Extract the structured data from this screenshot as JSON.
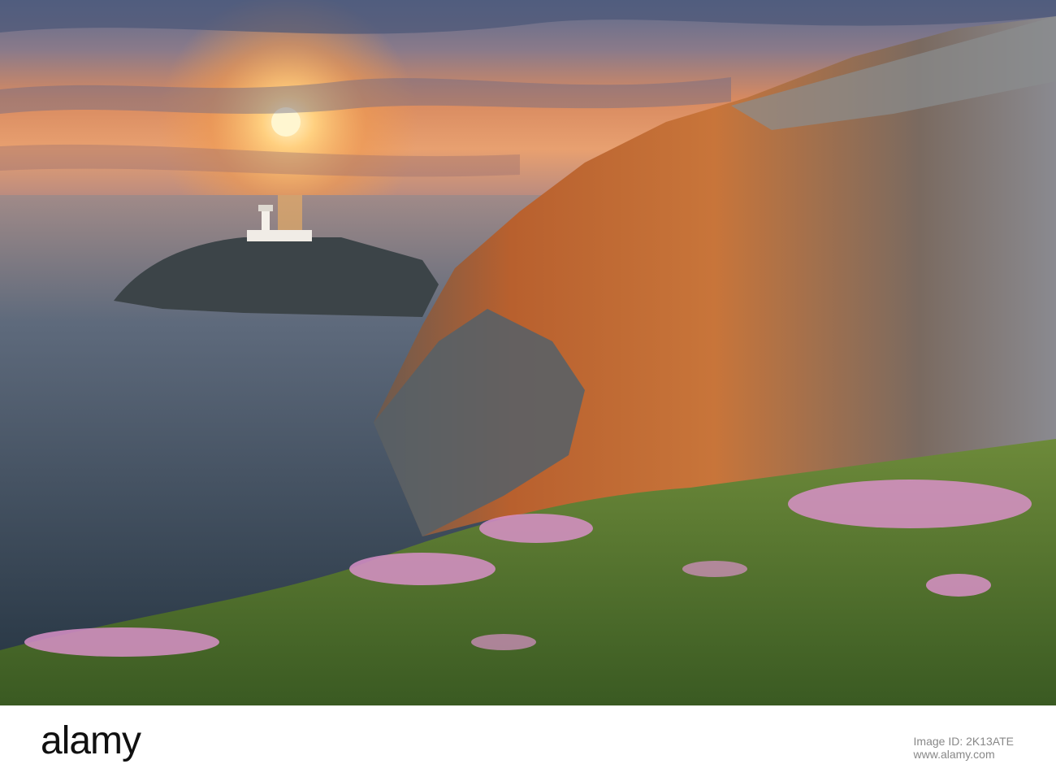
{
  "watermark": {
    "brand": "alamy",
    "repeat": "alamy"
  },
  "footer": {
    "logo_text": "alamy",
    "image_id_label": "Image ID:",
    "image_id": "2K13ATE",
    "website": "www.alamy.com"
  },
  "colors": {
    "sky_top": "#4a5a7a",
    "sky_glow": "#f2a25a",
    "sea": "#3a4a5c",
    "cliff_orange": "#c8632e",
    "grass": "#6a8a3a",
    "flower_pink": "#d88ac8"
  }
}
